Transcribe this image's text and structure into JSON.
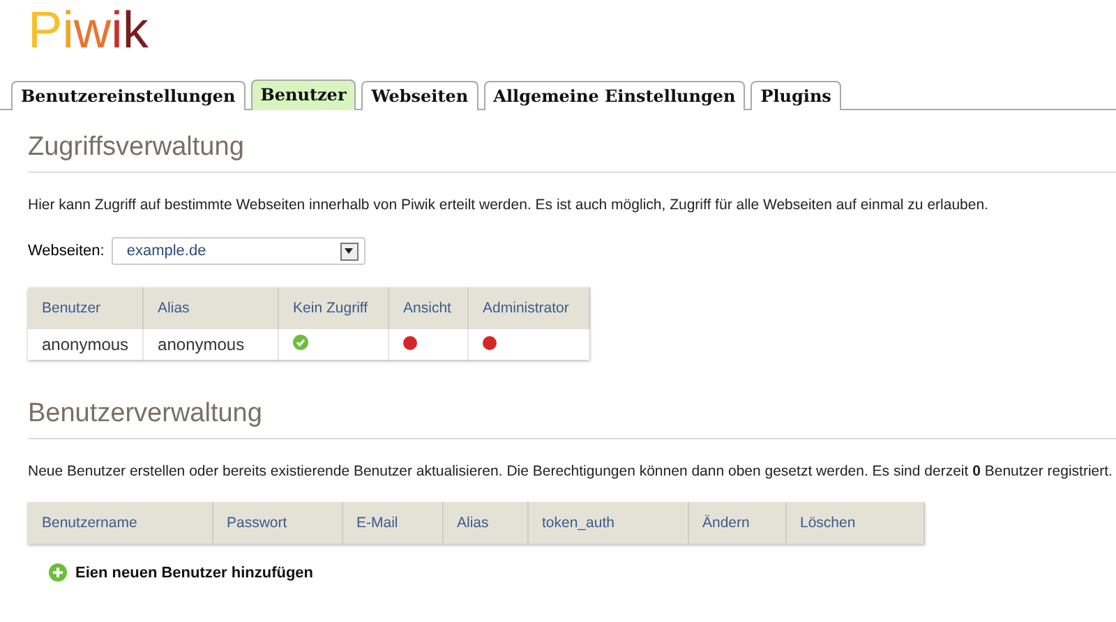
{
  "logo": "Piwik",
  "tabs": [
    {
      "label": "Benutzereinstellungen",
      "selected": false
    },
    {
      "label": "Benutzer",
      "selected": true
    },
    {
      "label": "Webseiten",
      "selected": false
    },
    {
      "label": "Allgemeine Einstellungen",
      "selected": false
    },
    {
      "label": "Plugins",
      "selected": false
    }
  ],
  "access": {
    "heading": "Zugriffsverwaltung",
    "description": "Hier kann Zugriff auf bestimmte Webseiten innerhalb von Piwik erteilt werden. Es ist auch möglich, Zugriff für alle Webseiten auf einmal zu erlauben.",
    "site_label": "Webseiten:",
    "site_value": "example.de",
    "table": {
      "columns": [
        "Benutzer",
        "Alias",
        "Kein Zugriff",
        "Ansicht",
        "Administrator"
      ],
      "rows": [
        {
          "user": "anonymous",
          "alias": "anonymous",
          "permissions": [
            {
              "selected": true
            },
            {
              "selected": false
            },
            {
              "selected": false
            }
          ]
        }
      ]
    }
  },
  "users": {
    "heading": "Benutzerverwaltung",
    "description": "Neue Benutzer erstellen oder bereits existierende Benutzer aktualisieren. Die Berechtigungen können dann oben gesetzt werden. Es sind derzeit **0** Benutzer registriert.",
    "table": {
      "columns": [
        "Benutzername",
        "Passwort",
        "E-Mail",
        "Alias",
        "token_auth",
        "Ändern",
        "Löschen"
      ]
    },
    "add_link": "Eien neuen Benutzer hinzufügen"
  }
}
